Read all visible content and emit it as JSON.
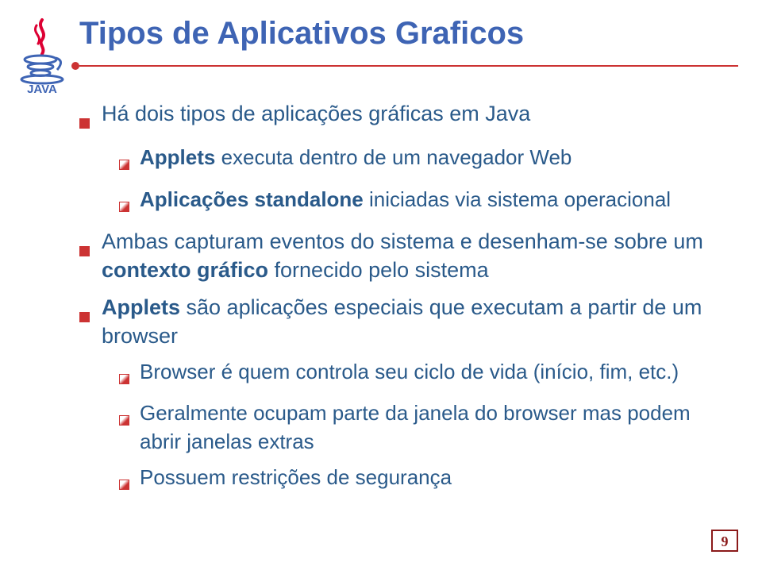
{
  "title": "Tipos de Aplicativos Graficos",
  "bullets": {
    "b1": "Há dois tipos de aplicações gráficas em Java",
    "b2_bold": "Applets",
    "b2_rest": " executa dentro de um navegador Web",
    "b3_bold": "Aplicações standalone",
    "b3_rest": " iniciadas via sistema operacional",
    "b4_a": "Ambas capturam eventos do sistema e desenham-se sobre um ",
    "b4_bold": "contexto gráfico",
    "b4_b": " fornecido pelo sistema",
    "b5_bold": "Applets",
    "b5_rest": " são aplicações especiais que executam a partir de um browser",
    "b6": "Browser é quem controla seu ciclo de vida (início, fim, etc.)",
    "b7": "Geralmente ocupam parte da janela do browser mas podem abrir janelas extras",
    "b8": "Possuem restrições de segurança"
  },
  "page_number": "9"
}
